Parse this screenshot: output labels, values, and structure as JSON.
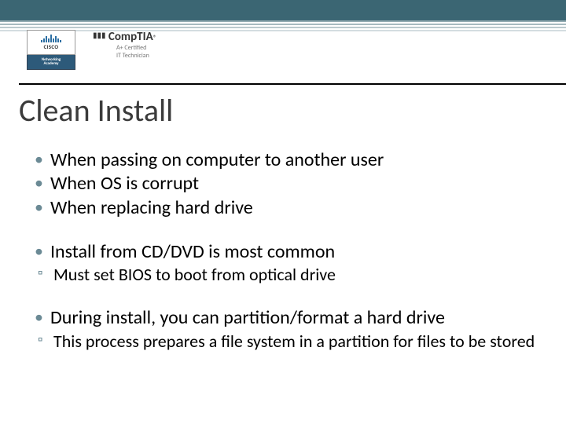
{
  "logos": {
    "cisco_word": "CISCO",
    "cisco_academy_line1": "Networking",
    "cisco_academy_line2": "Academy",
    "comptia_main": "CompTIA",
    "comptia_sub1": "A+ Certified",
    "comptia_sub2": "IT Technician"
  },
  "title": "Clean Install",
  "bullets": {
    "a1": "When passing on computer to another user",
    "a2": "When OS is corrupt",
    "a3": "When replacing hard drive",
    "b1": "Install from CD/DVD is most common",
    "b1s": "Must set BIOS to boot from optical drive",
    "c1": "During install, you can partition/format a hard drive",
    "c1s": "This process prepares a file system in a partition for files to be stored"
  }
}
